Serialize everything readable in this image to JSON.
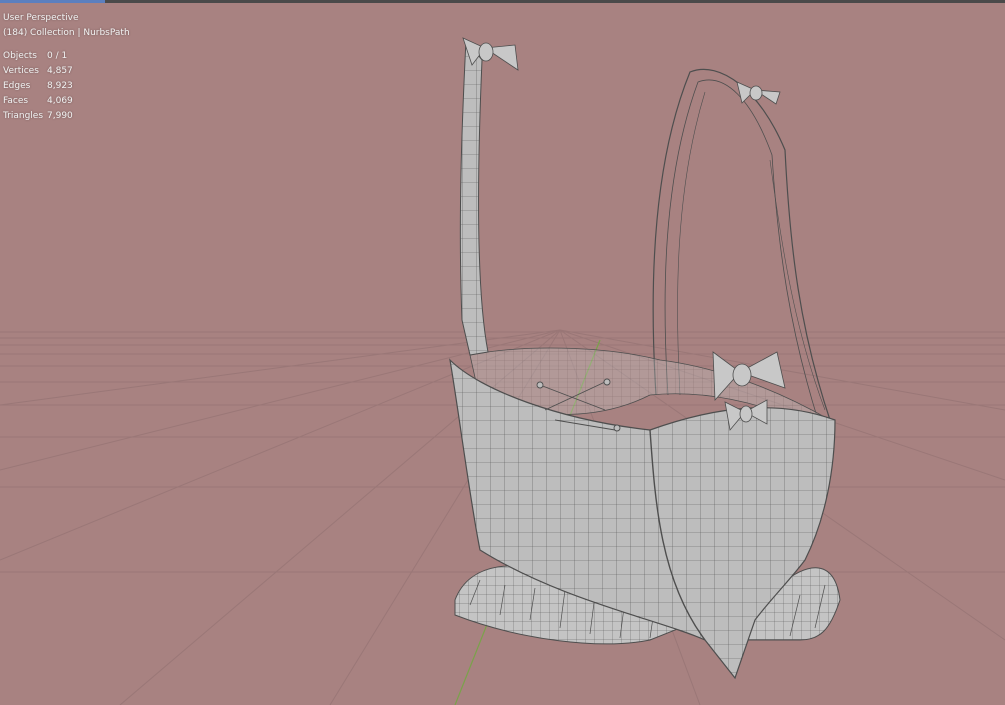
{
  "viewport": {
    "view_name": "User Perspective",
    "collection": "(184) Collection | NurbsPath",
    "stats": [
      {
        "label": "Objects",
        "value": "0 / 1"
      },
      {
        "label": "Vertices",
        "value": "4,857"
      },
      {
        "label": "Edges",
        "value": "8,923"
      },
      {
        "label": "Faces",
        "value": "4,069"
      },
      {
        "label": "Triangles",
        "value": "7,990"
      }
    ]
  },
  "colors": {
    "background": "#a88281",
    "grid_line": "#9a7777",
    "mesh_fill": "#bdbdbd",
    "wire": "#4e4e4e"
  },
  "icons": {
    "model": "corset-mesh"
  }
}
